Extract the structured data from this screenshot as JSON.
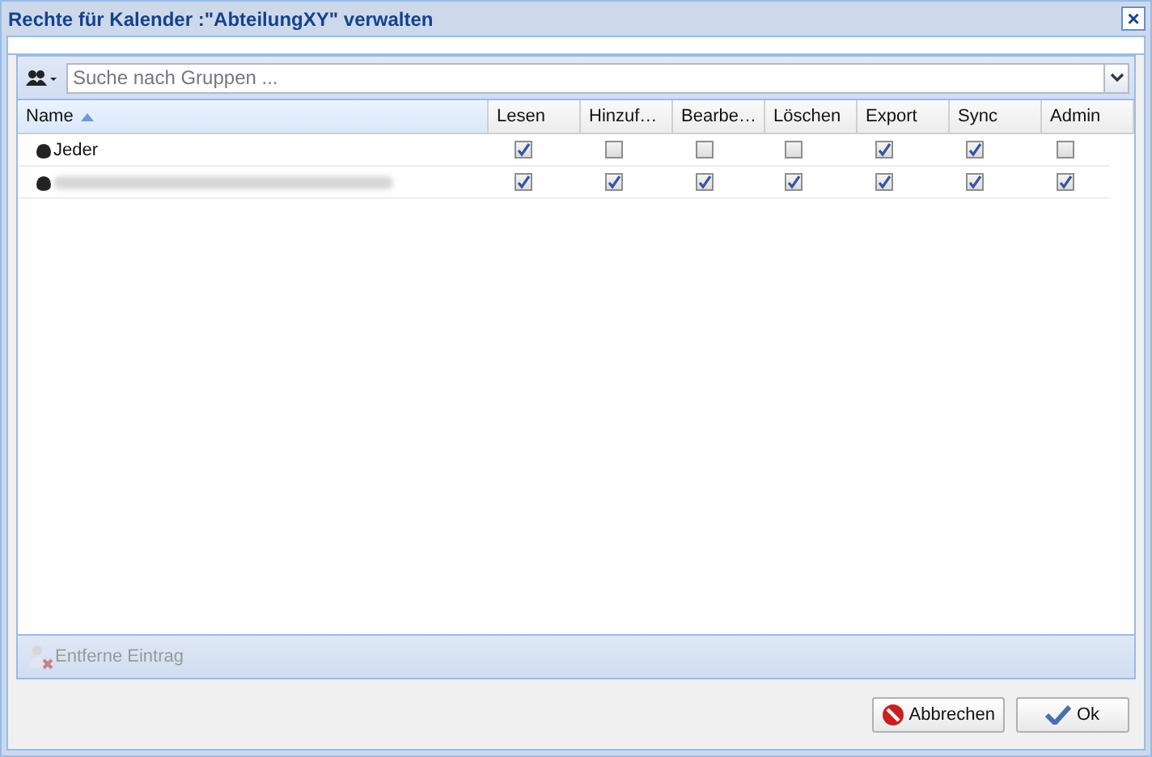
{
  "window": {
    "title": "Rechte für Kalender :\"AbteilungXY\" verwalten",
    "close": "×"
  },
  "search": {
    "placeholder": "Suche nach Gruppen ..."
  },
  "table": {
    "columns": [
      {
        "label": "Name",
        "sorted": true
      },
      {
        "label": "Lesen",
        "sorted": false
      },
      {
        "label": "Hinzuf…",
        "sorted": false
      },
      {
        "label": "Bearbe…",
        "sorted": false
      },
      {
        "label": "Löschen",
        "sorted": false
      },
      {
        "label": "Export",
        "sorted": false
      },
      {
        "label": "Sync",
        "sorted": false
      },
      {
        "label": "Admin",
        "sorted": false
      }
    ],
    "rows": [
      {
        "kind": "plain",
        "name": "Jeder",
        "rights": [
          {
            "checked": true
          },
          {
            "checked": false
          },
          {
            "checked": false
          },
          {
            "checked": false
          },
          {
            "checked": true
          },
          {
            "checked": true
          },
          {
            "checked": false
          }
        ]
      },
      {
        "kind": "redacted",
        "rights": [
          {
            "checked": true
          },
          {
            "checked": true
          },
          {
            "checked": true
          },
          {
            "checked": true
          },
          {
            "checked": true
          },
          {
            "checked": true
          },
          {
            "checked": true
          }
        ]
      }
    ]
  },
  "toolbar": {
    "remove_label": "Entferne Eintrag",
    "disabled": true
  },
  "buttons": [
    {
      "kind": "cancel",
      "label": "Abbrechen"
    },
    {
      "kind": "ok",
      "label": "Ok"
    }
  ]
}
